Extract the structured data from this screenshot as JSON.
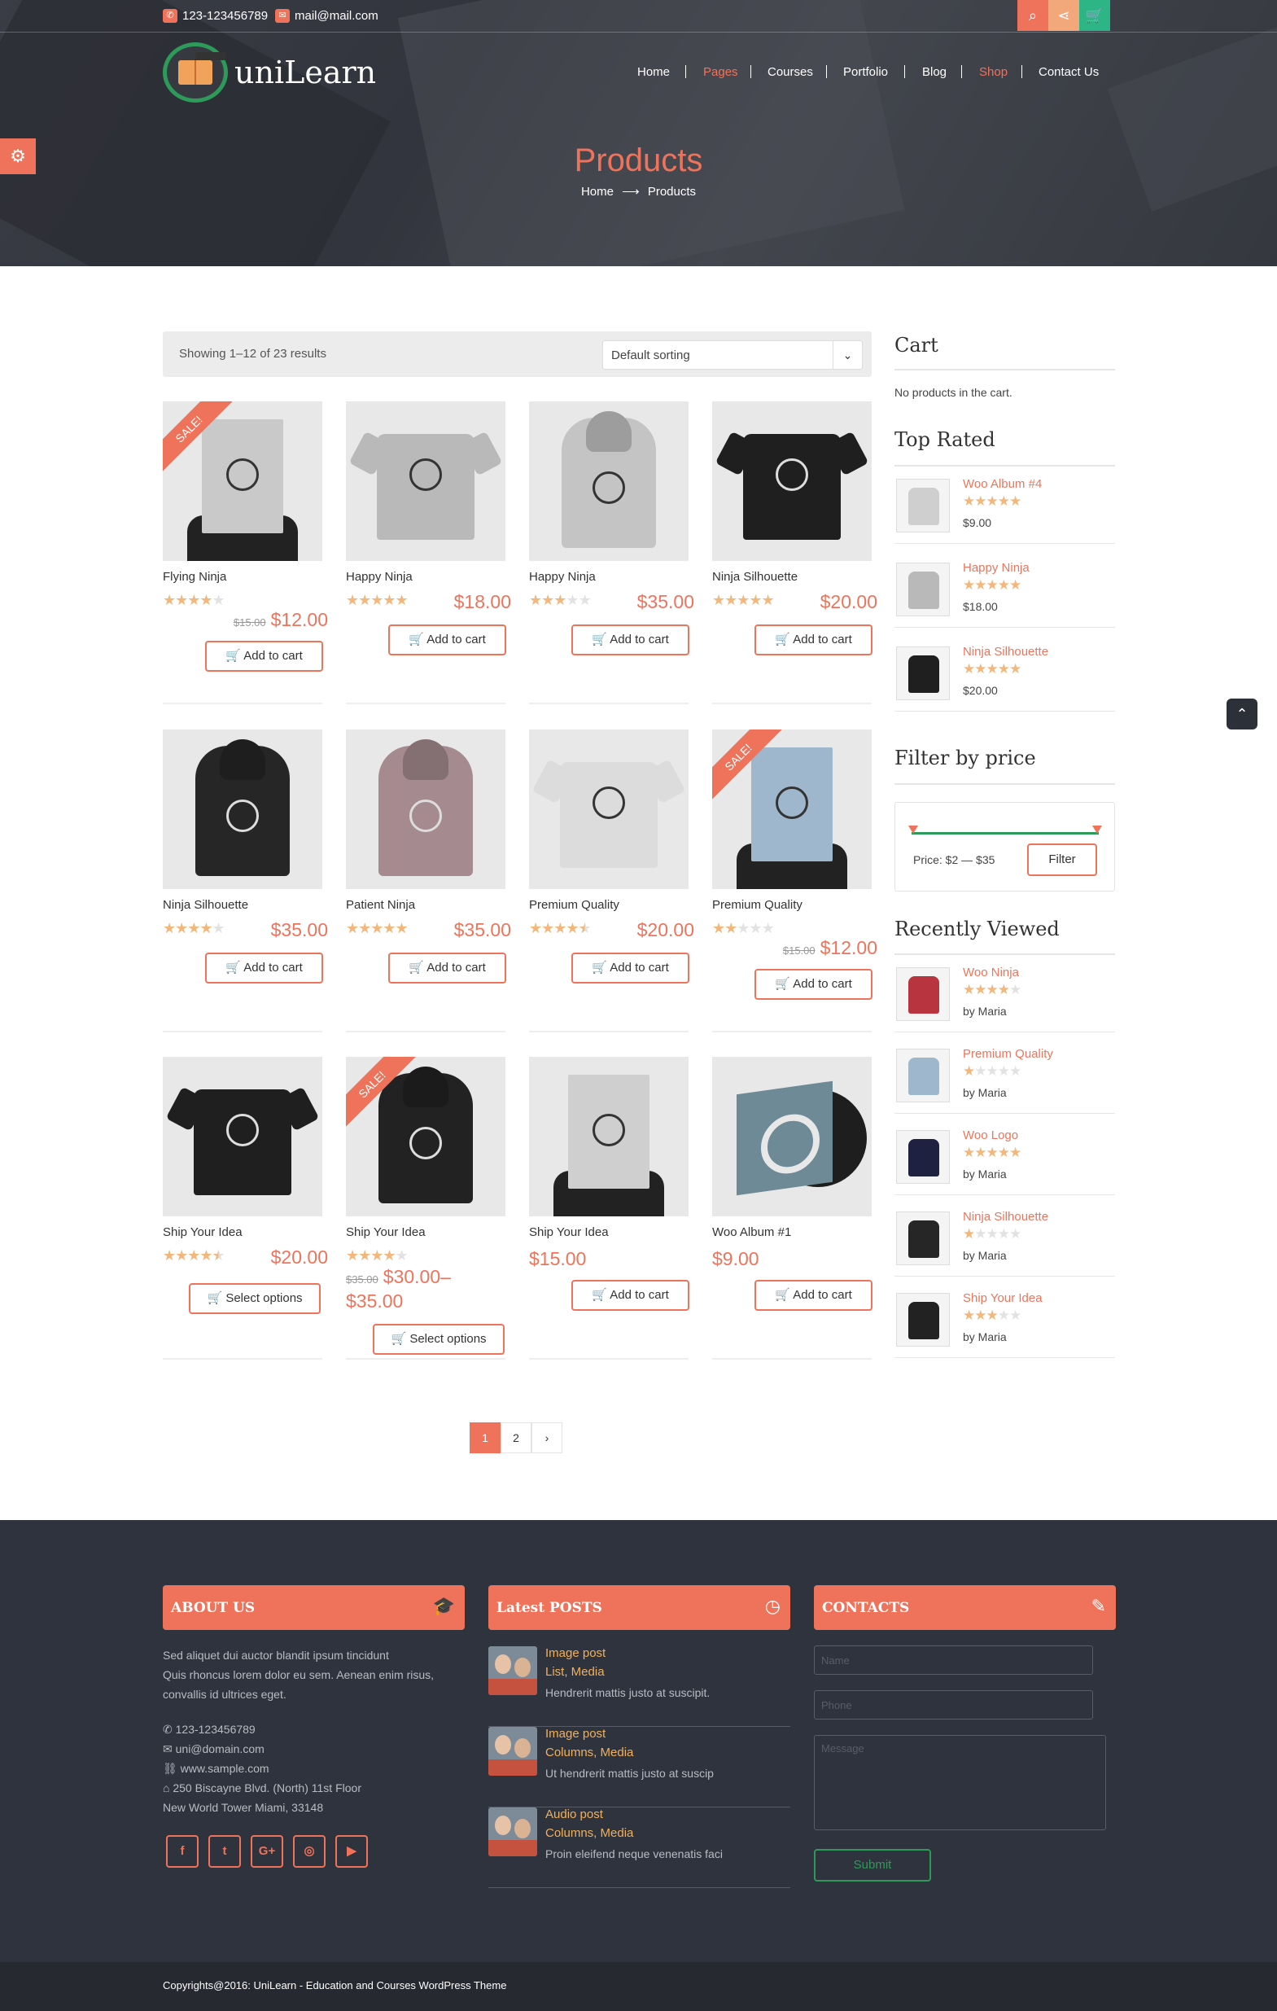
{
  "topbar": {
    "phone": "123-123456789",
    "email": "mail@mail.com"
  },
  "brand": {
    "name": "uniLearn"
  },
  "nav": [
    {
      "label": "Home",
      "active": false
    },
    {
      "label": "Pages",
      "active": true
    },
    {
      "label": "Courses",
      "active": false
    },
    {
      "label": "Portfolio",
      "active": false
    },
    {
      "label": "Blog",
      "active": false
    },
    {
      "label": "Shop",
      "active": true
    },
    {
      "label": "Contact Us",
      "active": false
    }
  ],
  "hero": {
    "title": "Products",
    "crumb_home": "Home",
    "crumb_arrow": "⟶",
    "crumb_current": "Products"
  },
  "shop": {
    "result_count": "Showing 1–12 of 23 results",
    "sort_value": "Default sorting",
    "sale_label": "SALE!",
    "products": [
      {
        "name": "Flying Ninja",
        "rating": 4,
        "old_price": "$15.00",
        "price": "$12.00",
        "sale": true,
        "button": "Add to cart"
      },
      {
        "name": "Happy Ninja",
        "rating": 5,
        "old_price": "",
        "price": "$18.00",
        "sale": false,
        "button": "Add to cart"
      },
      {
        "name": "Happy Ninja",
        "rating": 3,
        "old_price": "",
        "price": "$35.00",
        "sale": false,
        "button": "Add to cart"
      },
      {
        "name": "Ninja Silhouette",
        "rating": 5,
        "old_price": "",
        "price": "$20.00",
        "sale": false,
        "button": "Add to cart"
      },
      {
        "name": "Ninja Silhouette",
        "rating": 4,
        "old_price": "",
        "price": "$35.00",
        "sale": false,
        "button": "Add to cart"
      },
      {
        "name": "Patient Ninja",
        "rating": 5,
        "old_price": "",
        "price": "$35.00",
        "sale": false,
        "button": "Add to cart"
      },
      {
        "name": "Premium Quality",
        "rating": 4.5,
        "old_price": "",
        "price": "$20.00",
        "sale": false,
        "button": "Add to cart"
      },
      {
        "name": "Premium Quality",
        "rating": 2,
        "old_price": "$15.00",
        "price": "$12.00",
        "sale": true,
        "button": "Add to cart"
      },
      {
        "name": "Ship Your Idea",
        "rating": 4.5,
        "old_price": "",
        "price": "$20.00",
        "sale": false,
        "button": "Select options"
      },
      {
        "name": "Ship Your Idea",
        "rating": 4,
        "old_price": "$35.00",
        "price": "$30.00–",
        "price2": "$35.00",
        "sale": true,
        "button": "Select options"
      },
      {
        "name": "Ship Your Idea",
        "rating": 0,
        "old_price": "",
        "price": "$15.00",
        "sale": false,
        "button": "Add to cart"
      },
      {
        "name": "Woo Album #1",
        "rating": 0,
        "old_price": "",
        "price": "$9.00",
        "sale": false,
        "button": "Add to cart"
      }
    ],
    "pagination": [
      "1",
      "2",
      "›"
    ]
  },
  "sidebar": {
    "cart_title": "Cart",
    "cart_empty": "No products in the cart.",
    "top_rated_title": "Top Rated",
    "top_rated": [
      {
        "name": "Woo Album #4",
        "rating": 5,
        "price": "$9.00"
      },
      {
        "name": "Happy Ninja",
        "rating": 5,
        "price": "$18.00"
      },
      {
        "name": "Ninja Silhouette",
        "rating": 5,
        "price": "$20.00"
      }
    ],
    "filter_title": "Filter by price",
    "price_range": "Price: $2 — $35",
    "filter_button": "Filter",
    "recent_title": "Recently Viewed",
    "recent": [
      {
        "name": "Woo Ninja",
        "rating": 4,
        "by": "by Maria"
      },
      {
        "name": "Premium Quality",
        "rating": 1,
        "by": "by Maria"
      },
      {
        "name": "Woo Logo",
        "rating": 5,
        "by": "by Maria"
      },
      {
        "name": "Ninja Silhouette",
        "rating": 1,
        "by": "by Maria"
      },
      {
        "name": "Ship Your Idea",
        "rating": 3,
        "by": "by Maria"
      }
    ]
  },
  "footer": {
    "about_title": "ABOUT US",
    "about_text_1": "Sed aliquet dui auctor blandit ipsum tincidunt",
    "about_text_2": "Quis rhoncus lorem dolor eu sem. Aenean enim risus,",
    "about_text_3": "convallis id ultrices eget.",
    "phone": "123-123456789",
    "email": "uni@domain.com",
    "web": "www.sample.com",
    "address_1": "250 Biscayne Blvd. (North) 11st Floor",
    "address_2": "New World Tower Miami, 33148",
    "social": [
      "f",
      "t",
      "G+",
      "◎",
      "▶"
    ],
    "posts_title": "Latest POSTS",
    "posts": [
      {
        "title": "Image post",
        "cats": "List, Media",
        "excerpt": "Hendrerit mattis justo at suscipit."
      },
      {
        "title": "Image post",
        "cats": "Columns, Media",
        "excerpt": "Ut hendrerit mattis justo at suscip"
      },
      {
        "title": "Audio post",
        "cats": "Columns, Media",
        "excerpt": "Proin eleifend neque venenatis faci"
      }
    ],
    "contacts_title": "CONTACTS",
    "name_placeholder": "Name",
    "phone_placeholder": "Phone",
    "message_placeholder": "Message",
    "submit": "Submit",
    "copyright": "Copyrights@2016: UniLearn - Education and Courses WordPress Theme"
  },
  "colors": {
    "accent": "#ef735b",
    "green": "#2d9a5a",
    "star": "#f3b77c",
    "footer_bg": "#2f333d"
  }
}
